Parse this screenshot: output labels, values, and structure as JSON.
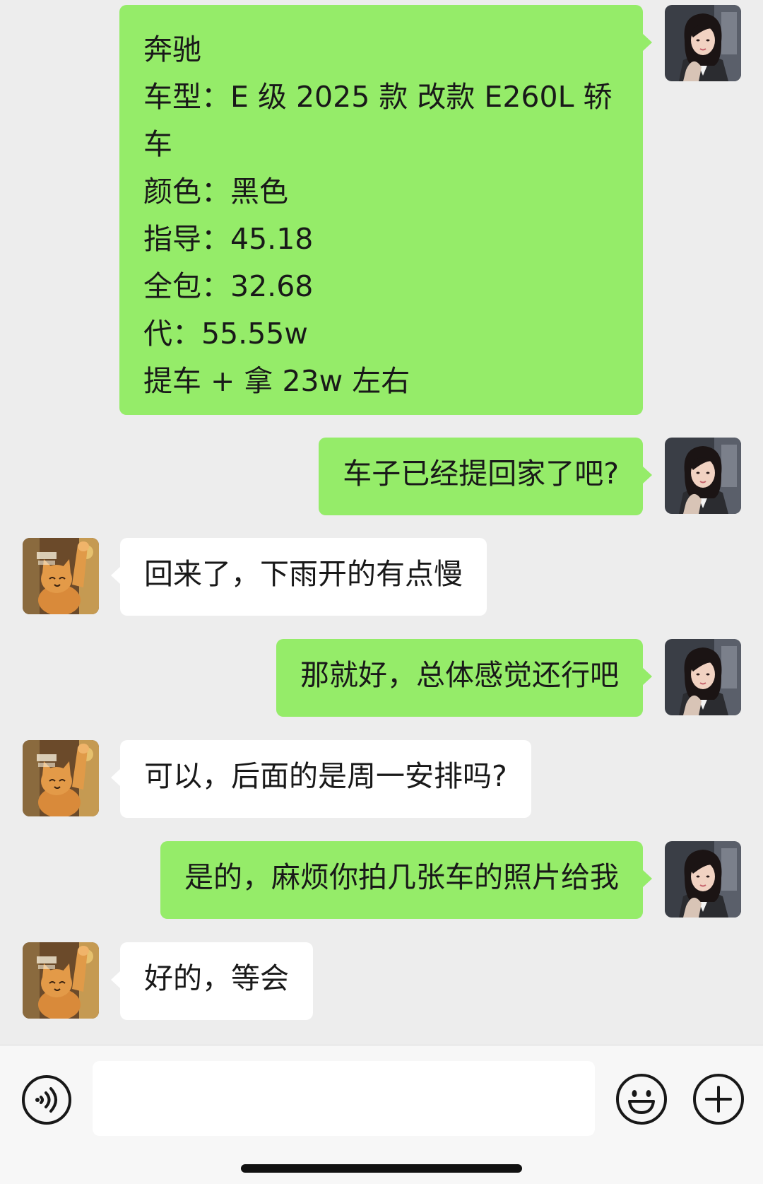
{
  "messages": [
    {
      "sender": "me",
      "lines": [
        "奔驰",
        "车型：E 级 2025 款 改款 E260L 轿",
        "车",
        "颜色：黑色",
        "指导：45.18",
        "全包：32.68",
        "代：55.55w",
        "提车 + 拿 23w 左右"
      ]
    },
    {
      "sender": "me",
      "text": "车子已经提回家了吧?"
    },
    {
      "sender": "other",
      "text": "回来了，下雨开的有点慢"
    },
    {
      "sender": "me",
      "text": "那就好，总体感觉还行吧"
    },
    {
      "sender": "other",
      "text": "可以，后面的是周一安排吗?"
    },
    {
      "sender": "me",
      "text": "是的，麻烦你拍几张车的照片给我"
    },
    {
      "sender": "other",
      "text": "好的，等会"
    }
  ],
  "colors": {
    "sent_bubble": "#95ec69",
    "received_bubble": "#ffffff",
    "background": "#ededed"
  },
  "input_bar": {
    "voice_icon": "voice-icon",
    "text_value": "",
    "emoji_icon": "emoji-icon",
    "plus_icon": "plus-icon"
  }
}
